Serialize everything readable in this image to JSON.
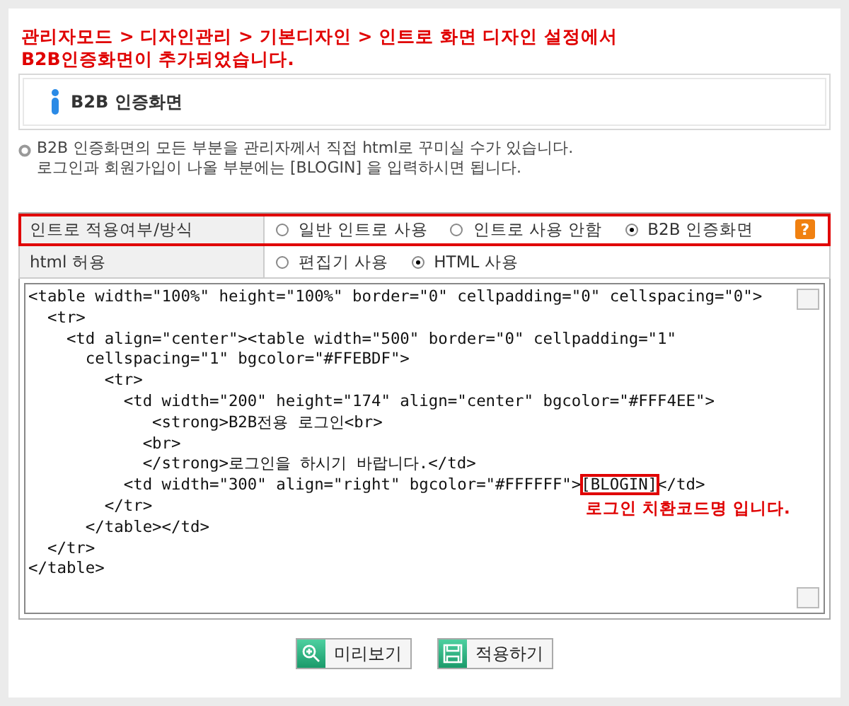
{
  "notice": "관리자모드 > 디자인관리 > 기본디자인 > 인트로 화면 디자인 설정에서\nB2B인증화면이 추가되었습니다.",
  "section_title": "B2B 인증화면",
  "help_lines": [
    "B2B 인증화면의 모든 부분을 관리자께서 직접 html로 꾸미실 수가 있습니다.",
    "로그인과 회원가입이 나올 부분에는 [BLOGIN] 을 입력하시면 됩니다."
  ],
  "settings": [
    {
      "label": "인트로 적용여부/방식",
      "highlighted": true,
      "help": "?",
      "options": [
        {
          "label": "일반 인트로 사용",
          "selected": false
        },
        {
          "label": "인트로 사용 안함",
          "selected": false
        },
        {
          "label": "B2B 인증화면",
          "selected": true
        }
      ]
    },
    {
      "label": "html 허용",
      "highlighted": false,
      "options": [
        {
          "label": "편집기 사용",
          "selected": false
        },
        {
          "label": "HTML 사용",
          "selected": true
        }
      ]
    }
  ],
  "code_lines": [
    {
      "text": "<table width=\"100%\" height=\"100%\" border=\"0\" cellpadding=\"0\" cellspacing=\"0\">"
    },
    {
      "text": "  <tr>"
    },
    {
      "text": "    <td align=\"center\"><table width=\"500\" border=\"0\" cellpadding=\"1\""
    },
    {
      "text": "      cellspacing=\"1\" bgcolor=\"#FFEBDF\">"
    },
    {
      "text": "        <tr>"
    },
    {
      "text": "          <td width=\"200\" height=\"174\" align=\"center\" bgcolor=\"#FFF4EE\">"
    },
    {
      "text": "             <strong>B2B전용 로그인<br>"
    },
    {
      "text": "            <br>"
    },
    {
      "text": "            </strong>로그인을 하시기 바랍니다.</td>"
    },
    {
      "text": "          <td width=\"300\" align=\"right\" bgcolor=\"#FFFFFF\">",
      "highlight": "[BLOGIN]",
      "after": "</td>"
    },
    {
      "text": "        </tr>"
    },
    {
      "text": "      </table></td>"
    },
    {
      "text": "  </tr>"
    },
    {
      "text": "</table>"
    }
  ],
  "code_annotation": "로그인 치환코드명 입니다.",
  "buttons": [
    {
      "kind": "preview",
      "label": "미리보기"
    },
    {
      "kind": "save",
      "label": "적용하기"
    }
  ]
}
